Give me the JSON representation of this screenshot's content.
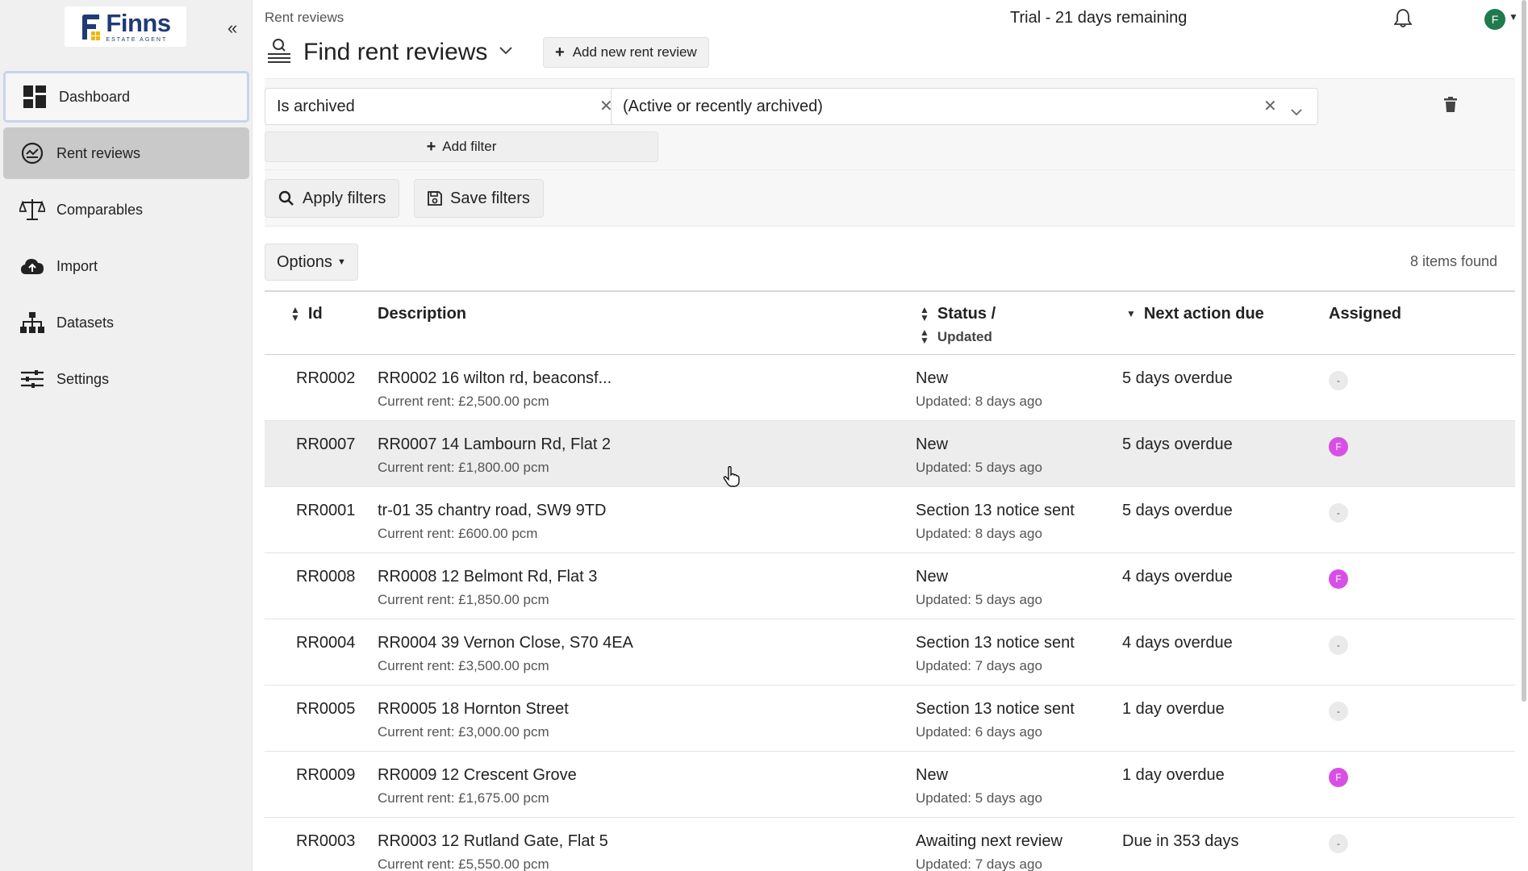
{
  "brand": {
    "name": "Finns",
    "subtitle": "ESTATE AGENT",
    "color": "#1f3b73"
  },
  "sidebar": {
    "collapse_label": "«",
    "items": [
      {
        "label": "Dashboard",
        "icon": "dashboard-icon"
      },
      {
        "label": "Rent reviews",
        "icon": "rent-review-icon"
      },
      {
        "label": "Comparables",
        "icon": "scale-icon"
      },
      {
        "label": "Import",
        "icon": "cloud-upload-icon"
      },
      {
        "label": "Datasets",
        "icon": "hierarchy-icon"
      },
      {
        "label": "Settings",
        "icon": "sliders-icon"
      }
    ]
  },
  "header": {
    "breadcrumb": "Rent reviews",
    "trial": "Trial - 21 days remaining",
    "avatar_initial": "F",
    "title": "Find rent reviews",
    "add_button": "Add new rent review"
  },
  "filters": {
    "field": "Is archived",
    "value": "(Active or recently archived)",
    "add_filter": "Add filter",
    "apply": "Apply filters",
    "save": "Save filters"
  },
  "toolbar": {
    "options": "Options",
    "items_found": "8 items found"
  },
  "table": {
    "headers": {
      "id": "Id",
      "description": "Description",
      "status": "Status /",
      "updated": "Updated",
      "next_action": "Next action due",
      "assigned": "Assigned"
    },
    "rows": [
      {
        "id": "RR0002",
        "description": "RR0002 16 wilton rd, beaconsf...",
        "rent": "Current rent: £2,500.00 pcm",
        "status": "New",
        "updated": "Updated: 8 days ago",
        "next": "5 days overdue",
        "assigned": "-"
      },
      {
        "id": "RR0007",
        "description": "RR0007 14 Lambourn Rd, Flat 2",
        "rent": "Current rent: £1,800.00 pcm",
        "status": "New",
        "updated": "Updated: 5 days ago",
        "next": "5 days overdue",
        "assigned": "F"
      },
      {
        "id": "RR0001",
        "description": "tr-01 35 chantry road, SW9 9TD",
        "rent": "Current rent: £600.00 pcm",
        "status": "Section 13 notice sent",
        "updated": "Updated: 8 days ago",
        "next": "5 days overdue",
        "assigned": "-"
      },
      {
        "id": "RR0008",
        "description": "RR0008 12 Belmont Rd, Flat 3",
        "rent": "Current rent: £1,850.00 pcm",
        "status": "New",
        "updated": "Updated: 5 days ago",
        "next": "4 days overdue",
        "assigned": "F"
      },
      {
        "id": "RR0004",
        "description": "RR0004 39 Vernon Close, S70 4EA",
        "rent": "Current rent: £3,500.00 pcm",
        "status": "Section 13 notice sent",
        "updated": "Updated: 7 days ago",
        "next": "4 days overdue",
        "assigned": "-"
      },
      {
        "id": "RR0005",
        "description": "RR0005 18 Hornton Street",
        "rent": "Current rent: £3,000.00 pcm",
        "status": "Section 13 notice sent",
        "updated": "Updated: 6 days ago",
        "next": "1 day overdue",
        "assigned": "-"
      },
      {
        "id": "RR0009",
        "description": "RR0009 12 Crescent Grove",
        "rent": "Current rent: £1,675.00 pcm",
        "status": "New",
        "updated": "Updated: 5 days ago",
        "next": "1 day overdue",
        "assigned": "F"
      },
      {
        "id": "RR0003",
        "description": "RR0003 12 Rutland Gate, Flat 5",
        "rent": "Current rent: £5,550.00 pcm",
        "status": "Awaiting next review",
        "updated": "Updated: 7 days ago",
        "next": "Due in 353 days",
        "assigned": "-"
      }
    ]
  },
  "colors": {
    "assignee": "#d84fe6",
    "avatar": "#1f7a4d",
    "active_nav": "#c9c9c9"
  }
}
